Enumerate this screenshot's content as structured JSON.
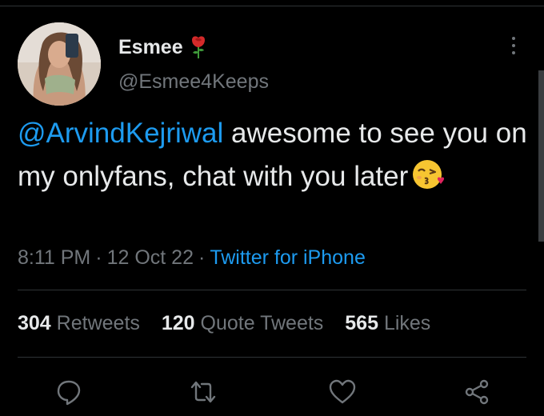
{
  "user": {
    "display_name": "Esmee",
    "handle": "@Esmee4Keeps",
    "badge_icon": "rose-icon"
  },
  "tweet": {
    "mention": "@ArvindKejriwal",
    "text": " awesome to see you on my onlyfans, chat with you later",
    "emoji_icon": "kissing-face-with-heart-icon"
  },
  "meta": {
    "time": "8:11 PM",
    "separator": "·",
    "date": "12 Oct 22",
    "source": "Twitter for iPhone"
  },
  "stats": {
    "retweets_count": "304",
    "retweets_label": "Retweets",
    "quotes_count": "120",
    "quotes_label": "Quote Tweets",
    "likes_count": "565",
    "likes_label": "Likes"
  },
  "actions": {
    "reply_icon": "reply-icon",
    "retweet_icon": "retweet-icon",
    "like_icon": "heart-icon",
    "share_icon": "share-icon"
  },
  "colors": {
    "background": "#000000",
    "text": "#e7e9ea",
    "secondary": "#71767b",
    "accent": "#1d9bf0",
    "divider": "#2f3336"
  }
}
